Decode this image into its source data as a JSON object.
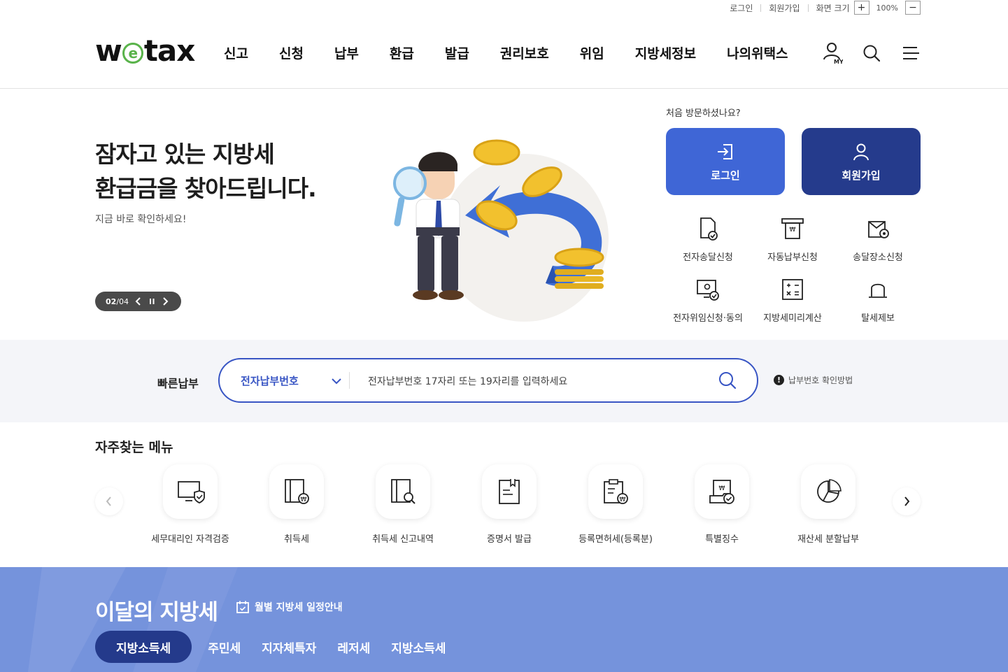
{
  "utility": {
    "login": "로그인",
    "signup": "회원가입",
    "zoom_label": "화면 크기",
    "zoom_in": "+",
    "zoom_value": "100%",
    "zoom_out": "−"
  },
  "header": {
    "logo_w": "w",
    "logo_e": "e",
    "logo_tax": "tax",
    "nav": [
      "신고",
      "신청",
      "납부",
      "환급",
      "발급",
      "권리보호",
      "위임",
      "지방세정보",
      "나의위택스"
    ],
    "my_label": "MY"
  },
  "hero": {
    "title_line1": "잠자고 있는 지방세",
    "title_line2": "환급금을 찾아드립니다.",
    "subtitle": "지금 바로 확인하세요!",
    "slide_current": "02",
    "slide_sep": "/",
    "slide_total": "04"
  },
  "member": {
    "first_visit": "처음 방문하셨나요?",
    "login_label": "로그인",
    "join_label": "회원가입",
    "services": [
      {
        "label": "전자송달신청",
        "icon": "doc-check-icon"
      },
      {
        "label": "자동납부신청",
        "icon": "auto-pay-icon"
      },
      {
        "label": "송달장소신청",
        "icon": "doc-location-icon"
      },
      {
        "label": "전자위임신청·동의",
        "icon": "monitor-delegate-icon"
      },
      {
        "label": "지방세미리계산",
        "icon": "calculator-icon"
      },
      {
        "label": "탈세제보",
        "icon": "siren-icon"
      }
    ]
  },
  "quick_pay": {
    "title": "빠른납부",
    "select_value": "전자납부번호",
    "input_value": "전자납부번호 17자리 또는 19자리를 입력하세요",
    "help": "납부번호 확인방법"
  },
  "favorites": {
    "title": "자주찾는 메뉴",
    "items": [
      {
        "label": "세무대리인 자격검증",
        "icon": "monitor-shield-icon"
      },
      {
        "label": "취득세",
        "icon": "book-won-icon"
      },
      {
        "label": "취득세 신고내역",
        "icon": "book-search-icon"
      },
      {
        "label": "증명서 발급",
        "icon": "certificate-icon"
      },
      {
        "label": "등록면허세(등록분)",
        "icon": "clipboard-won-icon"
      },
      {
        "label": "특별징수",
        "icon": "doc-won-check-icon"
      },
      {
        "label": "재산세 분할납부",
        "icon": "pie-chart-icon"
      }
    ]
  },
  "monthly": {
    "title": "이달의 지방세",
    "schedule": "월별 지방세 일정안내",
    "tabs": [
      "지방소득세",
      "주민세",
      "지자체특자",
      "레저세",
      "지방소득세"
    ]
  },
  "colors": {
    "primary_blue": "#3f66d6",
    "dark_blue": "#253b8c",
    "monthly_band": "#7593dc",
    "logo_green": "#59b34a"
  }
}
